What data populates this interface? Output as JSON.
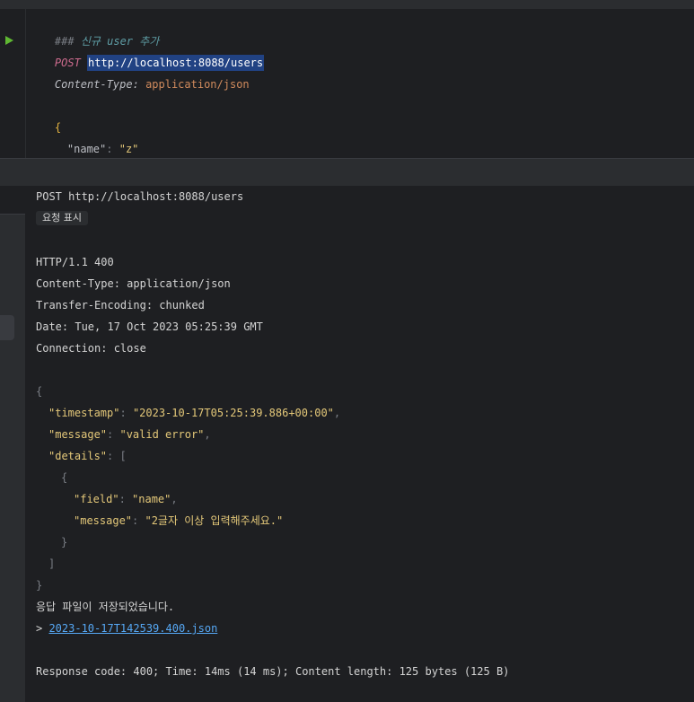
{
  "editor": {
    "comment_prefix": "###",
    "comment_text": "신규 user 추가",
    "method": "POST",
    "url": "http://localhost:8088/users",
    "header_name": "Content-Type:",
    "header_value": "application/json",
    "open_brace": "{",
    "body_key": "\"name\"",
    "body_colon": ":",
    "body_value": "\"z\"",
    "close_brace": "}"
  },
  "response": {
    "request_line": "POST http://localhost:8088/users",
    "show_request_label": "요청 표시",
    "status_line": "HTTP/1.1 400",
    "headers": [
      "Content-Type: application/json",
      "Transfer-Encoding: chunked",
      "Date: Tue, 17 Oct 2023 05:25:39 GMT",
      "Connection: close"
    ],
    "json": {
      "timestamp_key": "\"timestamp\"",
      "timestamp_val": "\"2023-10-17T05:25:39.886+00:00\"",
      "message_key": "\"message\"",
      "message_val": "\"valid error\"",
      "details_key": "\"details\"",
      "field_key": "\"field\"",
      "field_val": "\"name\"",
      "detail_message_key": "\"message\"",
      "detail_message_val": "\"2글자 이상 입력해주세요.\""
    },
    "saved_text": "응답 파일이 저장되었습니다.",
    "file_prefix": "> ",
    "file_link": "2023-10-17T142539.400.json",
    "summary": "Response code: 400; Time: 14ms (14 ms); Content length: 125 bytes (125 B)"
  },
  "colors": {
    "background": "#1e1f22",
    "panel": "#2b2d30",
    "run_icon": "#5fb832",
    "method": "#cf6c8f",
    "url_highlight": "#214283",
    "link": "#56a8f5",
    "json_string": "#e4c879"
  },
  "icons": {
    "run": "run-request-icon"
  }
}
